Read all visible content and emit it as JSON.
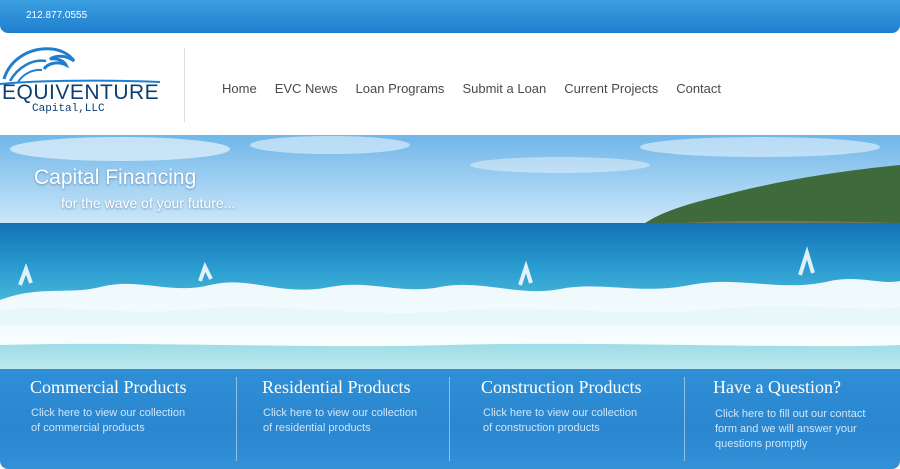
{
  "topbar": {
    "phone": "212.877.0555"
  },
  "logo": {
    "main": "EQUIVENTURE",
    "sub": "Capital,LLC"
  },
  "nav": {
    "items": [
      {
        "label": "Home"
      },
      {
        "label": "EVC News"
      },
      {
        "label": "Loan Programs"
      },
      {
        "label": "Submit a Loan"
      },
      {
        "label": "Current Projects"
      },
      {
        "label": "Contact"
      }
    ]
  },
  "hero": {
    "title": "Capital Financing",
    "subtitle": "for the wave of your future..."
  },
  "columns": [
    {
      "title": "Commercial Products",
      "text1": "Click here to view our collection",
      "text2": "of commercial products",
      "text3": ""
    },
    {
      "title": "Residential Products",
      "text1": "Click here to view our collection",
      "text2": "of residential products",
      "text3": ""
    },
    {
      "title": "Construction Products",
      "text1": "Click here to view our collection",
      "text2": "of construction products",
      "text3": ""
    },
    {
      "title": "Have a Question?",
      "text1": "Click here to fill out our contact",
      "text2": "form and we will answer your",
      "text3": "questions promptly"
    }
  ],
  "colors": {
    "brand_blue": "#1f7fcf",
    "logo_navy": "#0d3f73",
    "nav_text": "#4a4a4a"
  }
}
